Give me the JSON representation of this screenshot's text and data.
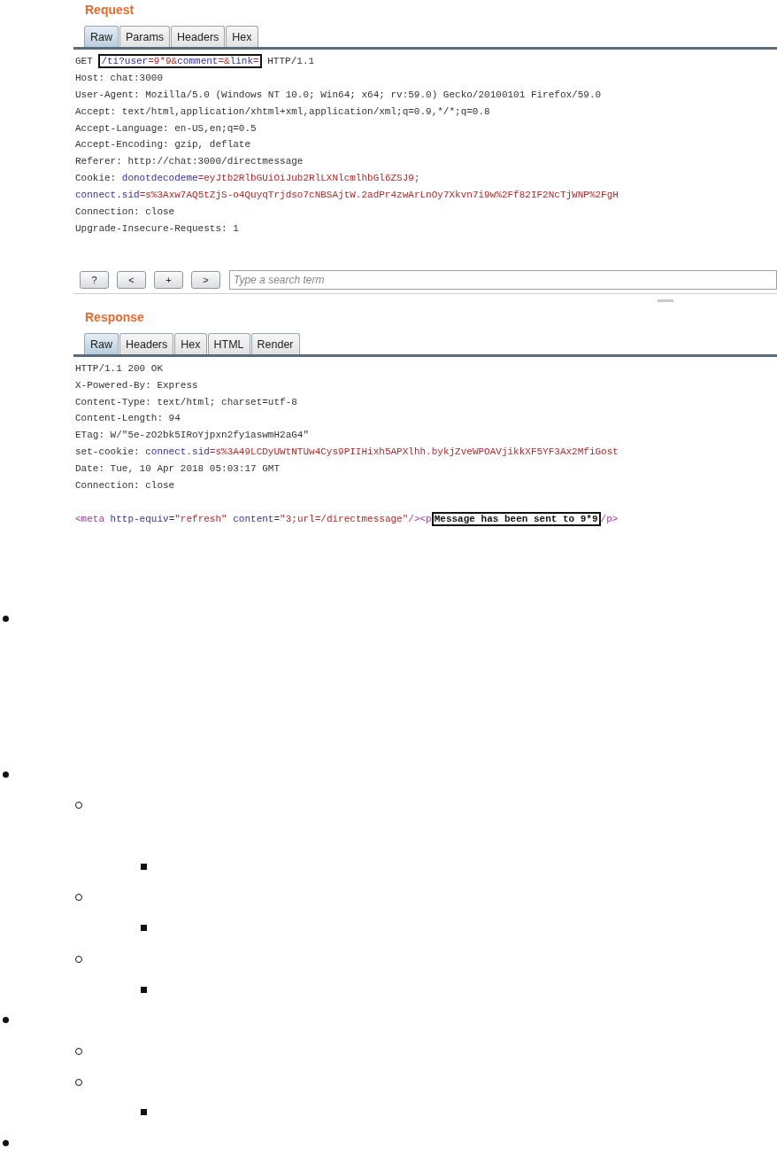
{
  "request": {
    "title": "Request",
    "tabs": [
      {
        "label": "Raw",
        "selected": true
      },
      {
        "label": "Params",
        "selected": false
      },
      {
        "label": "Headers",
        "selected": false
      },
      {
        "label": "Hex",
        "selected": false
      }
    ],
    "lines": [
      [
        {
          "kind": "plain",
          "text": "GET "
        },
        {
          "kind": "box",
          "parts": [
            {
              "kind": "key",
              "text": "/ti?user"
            },
            {
              "kind": "value",
              "text": "=9*9&"
            },
            {
              "kind": "key",
              "text": "comment"
            },
            {
              "kind": "value",
              "text": "=&"
            },
            {
              "kind": "key",
              "text": "link"
            },
            {
              "kind": "value",
              "text": "="
            }
          ]
        },
        {
          "kind": "plain",
          "text": " HTTP/1.1"
        }
      ],
      [
        {
          "kind": "plain",
          "text": "Host: chat:3000"
        }
      ],
      [
        {
          "kind": "plain",
          "text": "User-Agent: Mozilla/5.0 (Windows NT 10.0; Win64; x64; rv:59.0) Gecko/20100101 Firefox/59.0"
        }
      ],
      [
        {
          "kind": "plain",
          "text": "Accept: text/html,application/xhtml+xml,application/xml;q=0.9,*/*;q=0.8"
        }
      ],
      [
        {
          "kind": "plain",
          "text": "Accept-Language: en-US,en;q=0.5"
        }
      ],
      [
        {
          "kind": "plain",
          "text": "Accept-Encoding: gzip, deflate"
        }
      ],
      [
        {
          "kind": "plain",
          "text": "Referer: http://chat:3000/directmessage"
        }
      ],
      [
        {
          "kind": "plain",
          "text": "Cookie: "
        },
        {
          "kind": "key",
          "text": "donotdecodeme"
        },
        {
          "kind": "value",
          "text": "=eyJtb2RlbGUiOiJub2RlLXNlcmlhbGl6ZSJ9;"
        }
      ],
      [
        {
          "kind": "key",
          "text": "connect.sid"
        },
        {
          "kind": "value",
          "text": "=s%3Axw7AQ5tZjS-o4QuyqTrjdso7cNBSAjtW.2adPr4zwArLnOy7Xkvn7i9w%2Ff82IF2NcTjWNP%2FgH"
        }
      ],
      [
        {
          "kind": "plain",
          "text": "Connection: close"
        }
      ],
      [
        {
          "kind": "plain",
          "text": "Upgrade-Insecure-Requests: 1"
        }
      ]
    ]
  },
  "toolbar": {
    "buttons": [
      "?",
      "<",
      "+",
      ">"
    ],
    "search": {
      "placeholder": "Type a search term"
    }
  },
  "response": {
    "title": "Response",
    "tabs": [
      {
        "label": "Raw",
        "selected": true
      },
      {
        "label": "Headers",
        "selected": false
      },
      {
        "label": "Hex",
        "selected": false
      },
      {
        "label": "HTML",
        "selected": false
      },
      {
        "label": "Render",
        "selected": false
      }
    ],
    "lines": [
      [
        {
          "kind": "plain",
          "text": "HTTP/1.1 200 OK"
        }
      ],
      [
        {
          "kind": "plain",
          "text": "X-Powered-By: Express"
        }
      ],
      [
        {
          "kind": "plain",
          "text": "Content-Type: text/html; charset=utf-8"
        }
      ],
      [
        {
          "kind": "plain",
          "text": "Content-Length: 94"
        }
      ],
      [
        {
          "kind": "plain",
          "text": "ETag: W/\"5e-zO2bk5IRoYjpxn2fy1aswmH2aG4\""
        }
      ],
      [
        {
          "kind": "plain",
          "text": "set-cookie: "
        },
        {
          "kind": "key",
          "text": "connect.sid"
        },
        {
          "kind": "value",
          "text": "=s%3A49LCDyUWtNTUw4Cys9PIIHixh5APXlhh.bykjZveWPOAVjikkXF5YF3Ax2MfiGost"
        }
      ],
      [
        {
          "kind": "plain",
          "text": "Date: Tue, 10 Apr 2018 05:03:17 GMT"
        }
      ],
      [
        {
          "kind": "plain",
          "text": "Connection: close"
        }
      ]
    ],
    "body": [
      [
        {
          "kind": "tag",
          "text": "<meta "
        },
        {
          "kind": "key",
          "text": "http-equiv"
        },
        {
          "kind": "plain",
          "text": "="
        },
        {
          "kind": "value",
          "text": "\"refresh\" "
        },
        {
          "kind": "key",
          "text": "content"
        },
        {
          "kind": "plain",
          "text": "="
        },
        {
          "kind": "value",
          "text": "\"3;url=/directmessage\""
        },
        {
          "kind": "tag",
          "text": "/><p"
        },
        {
          "kind": "box",
          "parts": [
            {
              "kind": "bold",
              "text": "Message has been sent to 9*9"
            }
          ]
        },
        {
          "kind": "tag",
          "text": "/p>"
        }
      ]
    ]
  },
  "list": [
    {
      "kind": "paragraph"
    },
    {
      "kind": "single",
      "children": [
        {
          "kind": "double",
          "children": [
            {
              "kind": "single"
            }
          ]
        },
        {
          "kind": "single",
          "children": [
            {
              "kind": "single"
            }
          ]
        },
        {
          "kind": "single",
          "children": [
            {
              "kind": "single"
            }
          ]
        }
      ]
    },
    {
      "kind": "single",
      "children": [
        {
          "kind": "single"
        },
        {
          "kind": "single",
          "children": [
            {
              "kind": "single"
            }
          ]
        }
      ]
    },
    {
      "kind": "single"
    }
  ]
}
